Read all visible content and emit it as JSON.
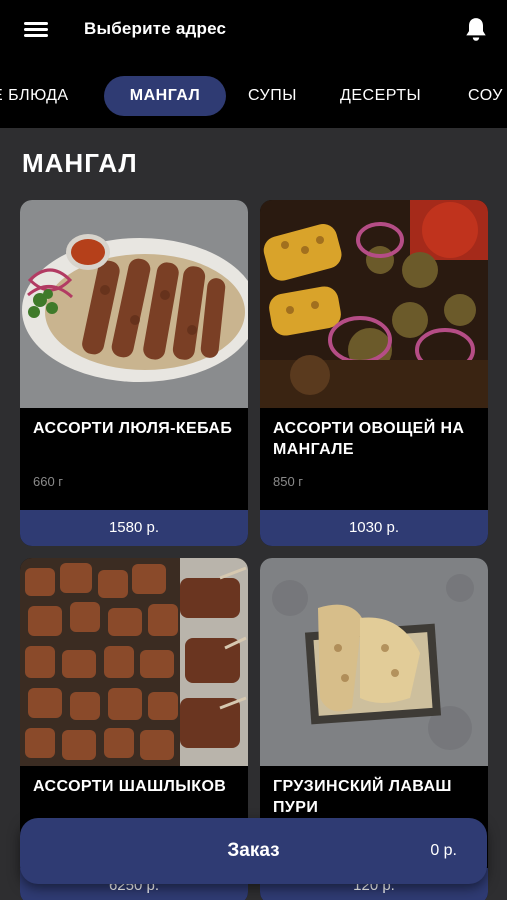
{
  "header": {
    "address_label": "Выберите адрес",
    "menu_icon": "hamburger-menu-icon",
    "notification_icon": "bell-icon"
  },
  "tabs": [
    {
      "label": "Е БЛЮДА"
    },
    {
      "label": "МАНГАЛ",
      "active": true
    },
    {
      "label": "СУПЫ"
    },
    {
      "label": "ДЕСЕРТЫ"
    },
    {
      "label": "СОУ"
    }
  ],
  "section": {
    "title": "МАНГАЛ"
  },
  "products": [
    {
      "name": "Ассорти люля-кебаб",
      "weight": "660 г",
      "price": "1580 р."
    },
    {
      "name": "Ассорти овощей на мангале",
      "weight": "850 г",
      "price": "1030 р."
    },
    {
      "name": "Ассорти шашлыков",
      "weight": "",
      "price": "6250 р."
    },
    {
      "name": "Грузинский лаваш пури",
      "weight": "",
      "price": "120 р."
    }
  ],
  "order": {
    "label": "Заказ",
    "total": "0 р."
  },
  "colors": {
    "accent": "#2f3b73",
    "background": "#2e2e30",
    "bar": "#000000"
  }
}
